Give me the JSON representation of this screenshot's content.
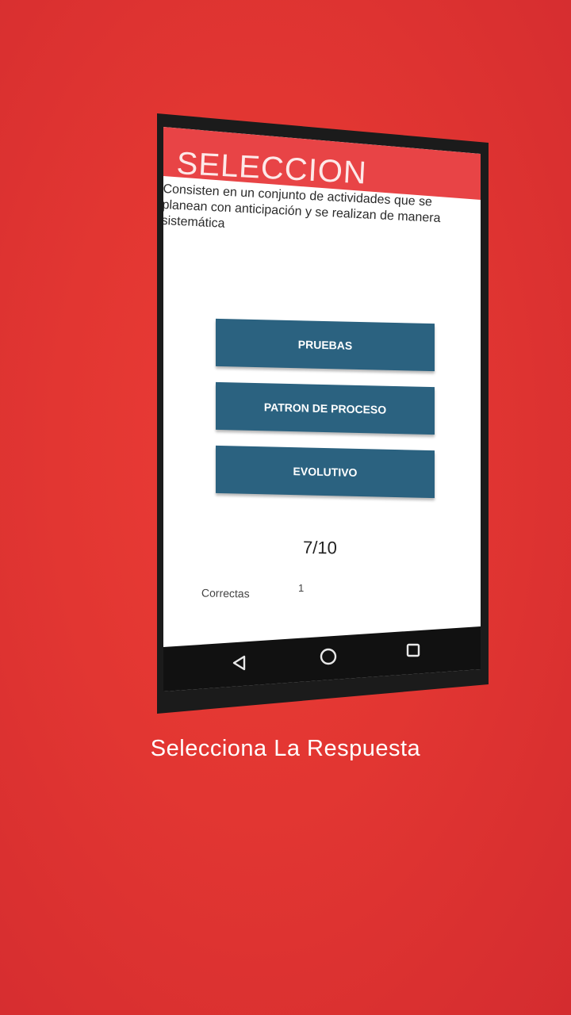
{
  "app": {
    "title": "SELECCION"
  },
  "question": {
    "text": "Consisten en un conjunto de actividades que se planean con anticipación y se realizan de manera sistemática"
  },
  "answers": [
    {
      "label": "PRUEBAS"
    },
    {
      "label": "PATRON DE PROCESO"
    },
    {
      "label": "EVOLUTIVO"
    }
  ],
  "progress": {
    "score_text": "7/10",
    "correct_label": "Correctas",
    "correct_value": "1"
  },
  "navigation": {
    "icons": [
      "back-triangle-icon",
      "home-circle-icon",
      "recents-square-icon"
    ]
  },
  "caption": {
    "text": "Selecciona La Respuesta"
  },
  "colors": {
    "background": "#e23632",
    "app_bar": "#e84446",
    "button": "#2b6280",
    "nav_bar": "#111111"
  }
}
